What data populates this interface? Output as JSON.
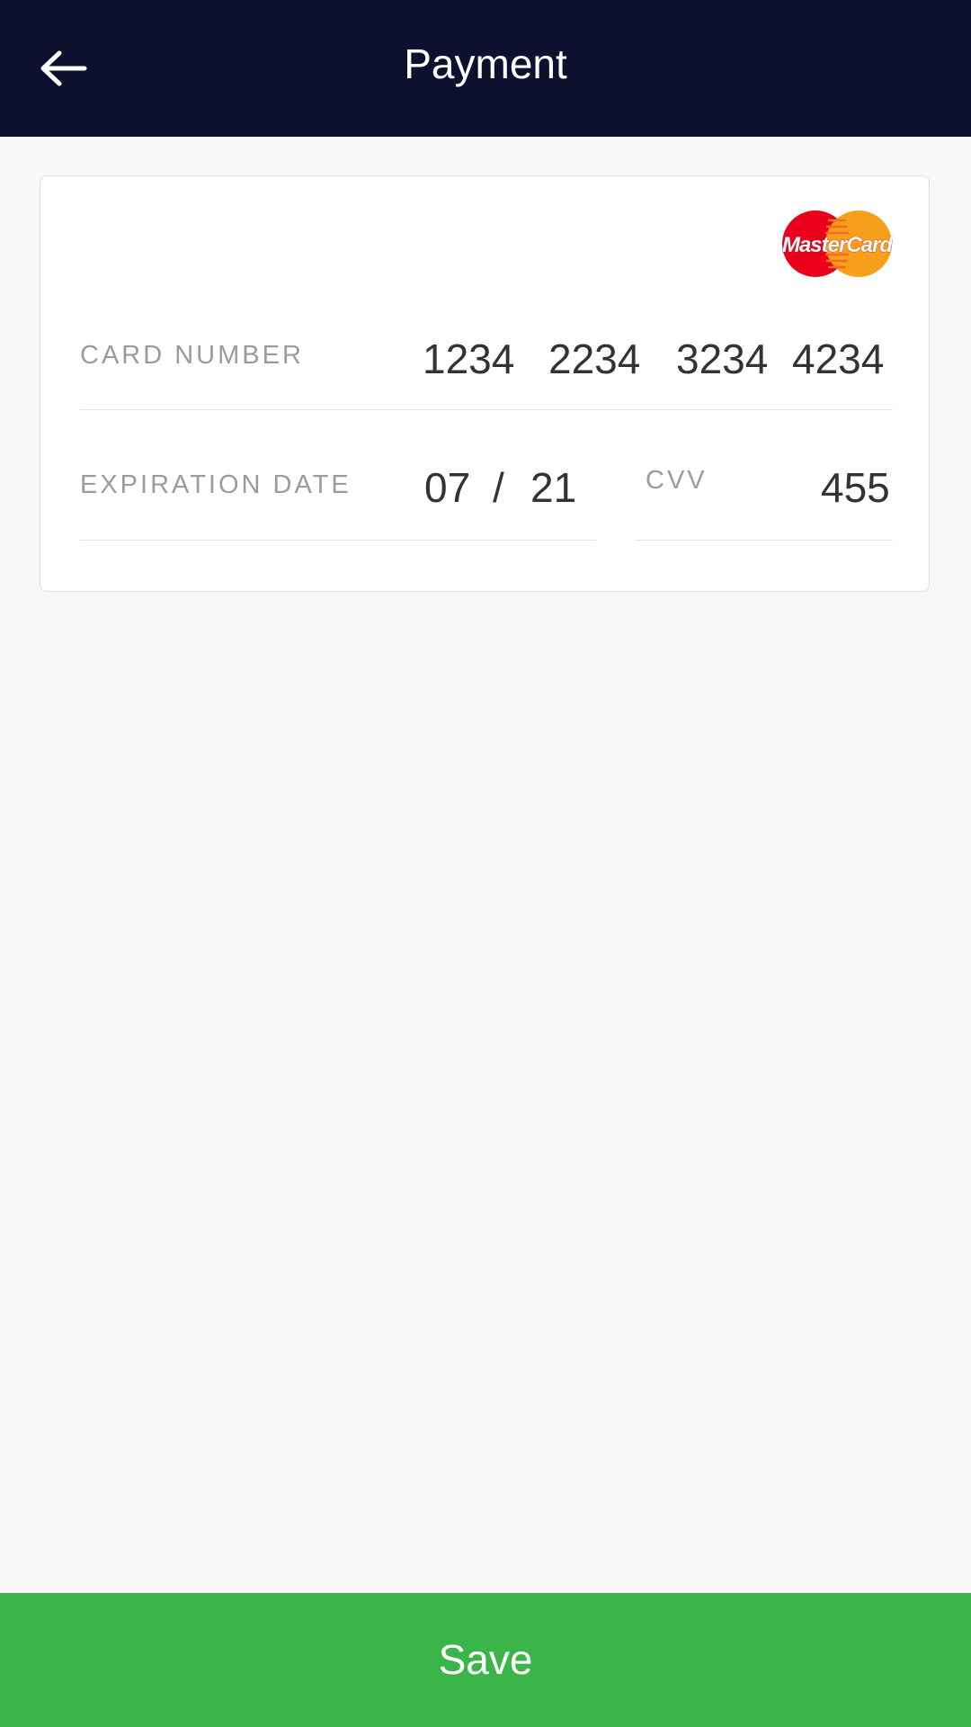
{
  "header": {
    "title": "Payment",
    "back_icon": "arrow-left-icon"
  },
  "card": {
    "brand": {
      "name": "MasterCard",
      "colors": {
        "red": "#eb001b",
        "orange": "#f79e1b"
      }
    },
    "card_number": {
      "label": "CARD NUMBER",
      "groups": [
        "1234",
        "2234",
        "3234",
        "4234"
      ]
    },
    "expiration": {
      "label": "EXPIRATION DATE",
      "month": "07",
      "separator": "/",
      "year": "21"
    },
    "cvv": {
      "label": "CVV",
      "value": "455"
    }
  },
  "footer": {
    "save_label": "Save"
  },
  "colors": {
    "header_bg": "#0e1030",
    "save_bg": "#3bb54a",
    "page_bg": "#f8f8f8"
  }
}
